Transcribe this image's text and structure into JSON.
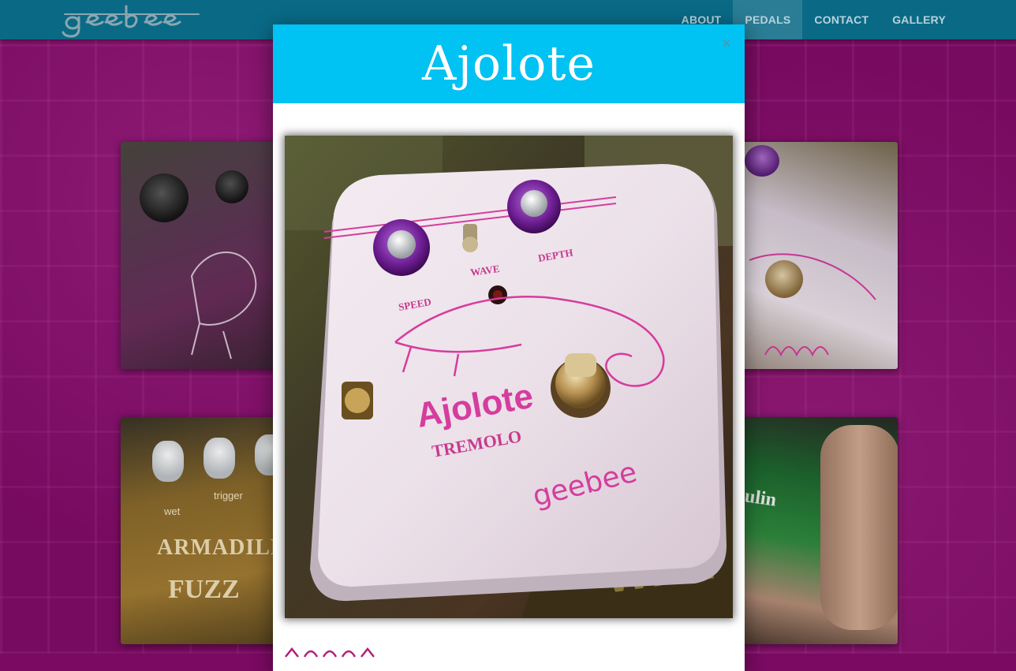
{
  "navbar": {
    "logo_text": "geebee",
    "links": [
      {
        "label": "ABOUT",
        "active": false
      },
      {
        "label": "PEDALS",
        "active": true
      },
      {
        "label": "CONTACT",
        "active": false
      },
      {
        "label": "GALLERY",
        "active": false
      }
    ]
  },
  "colors": {
    "page_background": "#820c68",
    "navbar": "#0a6a86",
    "nav_active": "#2a7d95",
    "modal_header": "#00c2f3",
    "pedal_print": "#d63c9e"
  },
  "thumbnails": [
    {
      "label": "purple pedal"
    },
    {
      "label": "pink pedal"
    },
    {
      "label": "armadillo fuzz pedal",
      "text_lines": [
        "wet",
        "trigger",
        "ARMADILLO",
        "FUZZ"
      ]
    },
    {
      "label": "green pedal",
      "text_lines": [
        "ulin"
      ]
    }
  ],
  "modal": {
    "title": "Ajolote",
    "close_label": "×",
    "photo": {
      "pedal_name": "Ajolote",
      "pedal_type": "TREMOLO",
      "brand": "geebee",
      "knob_labels": [
        "SPEED",
        "WAVE",
        "DEPTH"
      ]
    }
  }
}
